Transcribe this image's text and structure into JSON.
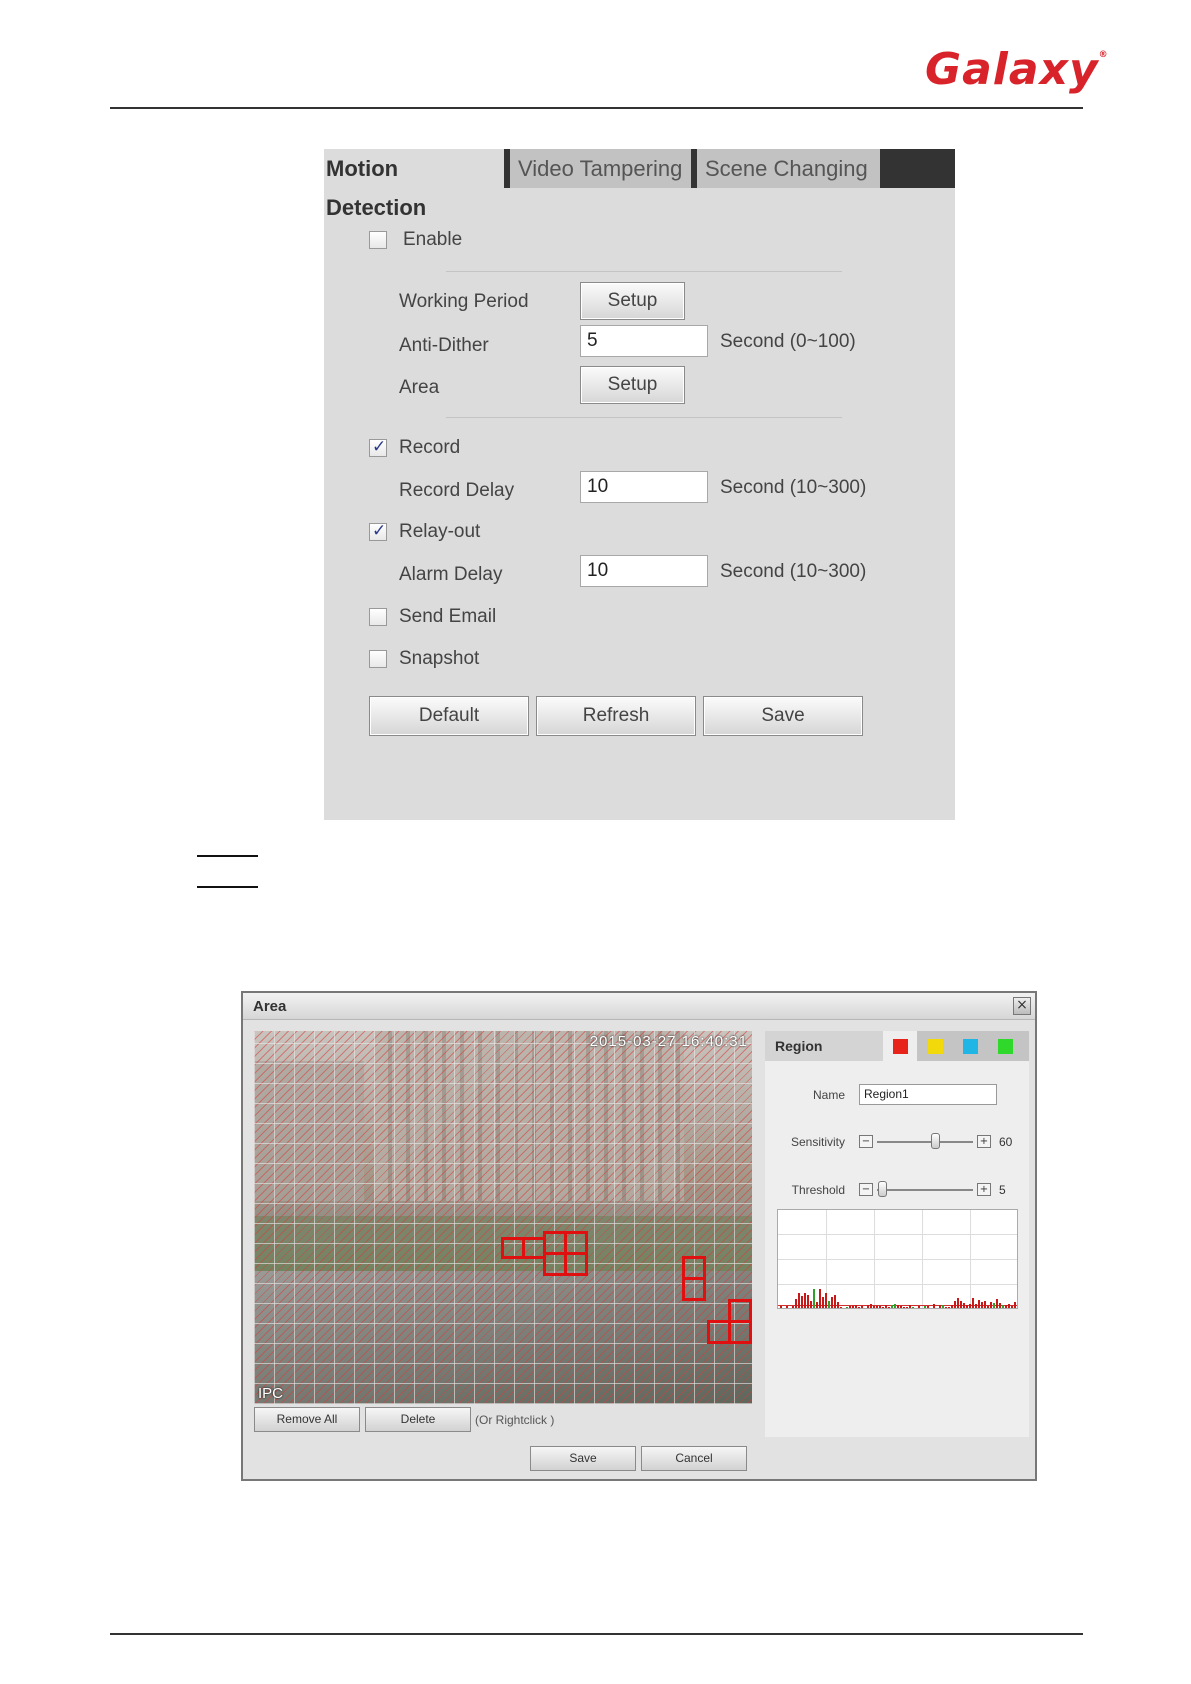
{
  "brand": {
    "logo_text": "Galaxy",
    "logo_mark": "®"
  },
  "motion_panel": {
    "tabs": [
      {
        "label": "Motion Detection",
        "active": true
      },
      {
        "label": "Video Tampering",
        "active": false
      },
      {
        "label": "Scene Changing",
        "active": false
      }
    ],
    "enable": {
      "label": "Enable",
      "checked": false
    },
    "working_period": {
      "label": "Working Period",
      "button": "Setup"
    },
    "anti_dither": {
      "label": "Anti-Dither",
      "value": "5",
      "unit": "Second (0~100)"
    },
    "area": {
      "label": "Area",
      "button": "Setup"
    },
    "record": {
      "label": "Record",
      "checked": true
    },
    "record_delay": {
      "label": "Record Delay",
      "value": "10",
      "unit": "Second (10~300)"
    },
    "relay_out": {
      "label": "Relay-out",
      "checked": true
    },
    "alarm_delay": {
      "label": "Alarm Delay",
      "value": "10",
      "unit": "Second (10~300)"
    },
    "send_email": {
      "label": "Send Email",
      "checked": false
    },
    "snapshot": {
      "label": "Snapshot",
      "checked": false
    },
    "buttons": {
      "default": "Default",
      "refresh": "Refresh",
      "save": "Save"
    }
  },
  "area_dialog": {
    "title": "Area",
    "close_glyph": "×",
    "video": {
      "timestamp": "2015-03-27 16:40:31",
      "channel_label": "IPC"
    },
    "remove_all": "Remove All",
    "delete": "Delete",
    "hint": "(Or Rightclick )",
    "save": "Save",
    "cancel": "Cancel",
    "region": {
      "header": "Region",
      "colors": [
        "#e8231a",
        "#f2d90c",
        "#1fb6e6",
        "#2fd82a"
      ],
      "selected_color_index": 0,
      "name_label": "Name",
      "name_value": "Region1",
      "sensitivity_label": "Sensitivity",
      "sensitivity_value": "60",
      "threshold_label": "Threshold",
      "threshold_value": "5",
      "minus_glyph": "−",
      "plus_glyph": "+"
    }
  }
}
